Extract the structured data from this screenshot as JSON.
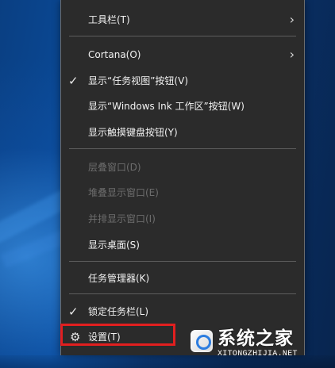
{
  "menu": {
    "items": [
      {
        "label": "工具栏(T)",
        "submenu": true,
        "checked": false,
        "disabled": false,
        "icon": ""
      },
      {
        "label": "Cortana(O)",
        "submenu": true,
        "checked": false,
        "disabled": false,
        "icon": ""
      },
      {
        "label": "显示“任务视图”按钮(V)",
        "submenu": false,
        "checked": true,
        "disabled": false,
        "icon": ""
      },
      {
        "label": "显示“Windows Ink 工作区”按钮(W)",
        "submenu": false,
        "checked": false,
        "disabled": false,
        "icon": ""
      },
      {
        "label": "显示触摸键盘按钮(Y)",
        "submenu": false,
        "checked": false,
        "disabled": false,
        "icon": ""
      },
      {
        "label": "层叠窗口(D)",
        "submenu": false,
        "checked": false,
        "disabled": true,
        "icon": ""
      },
      {
        "label": "堆叠显示窗口(E)",
        "submenu": false,
        "checked": false,
        "disabled": true,
        "icon": ""
      },
      {
        "label": "并排显示窗口(I)",
        "submenu": false,
        "checked": false,
        "disabled": true,
        "icon": ""
      },
      {
        "label": "显示桌面(S)",
        "submenu": false,
        "checked": false,
        "disabled": false,
        "icon": ""
      },
      {
        "label": "任务管理器(K)",
        "submenu": false,
        "checked": false,
        "disabled": false,
        "icon": ""
      },
      {
        "label": "锁定任务栏(L)",
        "submenu": false,
        "checked": true,
        "disabled": false,
        "icon": ""
      },
      {
        "label": "设置(T)",
        "submenu": false,
        "checked": false,
        "disabled": false,
        "icon": "gear-icon"
      }
    ]
  },
  "watermark": {
    "brand": "系统之家",
    "url": "XITONGZHIJIA.NET"
  },
  "colors": {
    "menu_bg": "#2b2b2b",
    "menu_text": "#f2f2f2",
    "menu_disabled_text": "#6d6d6d",
    "highlight": "#e21f1f",
    "desktop_blue": "#0a4c9c"
  }
}
